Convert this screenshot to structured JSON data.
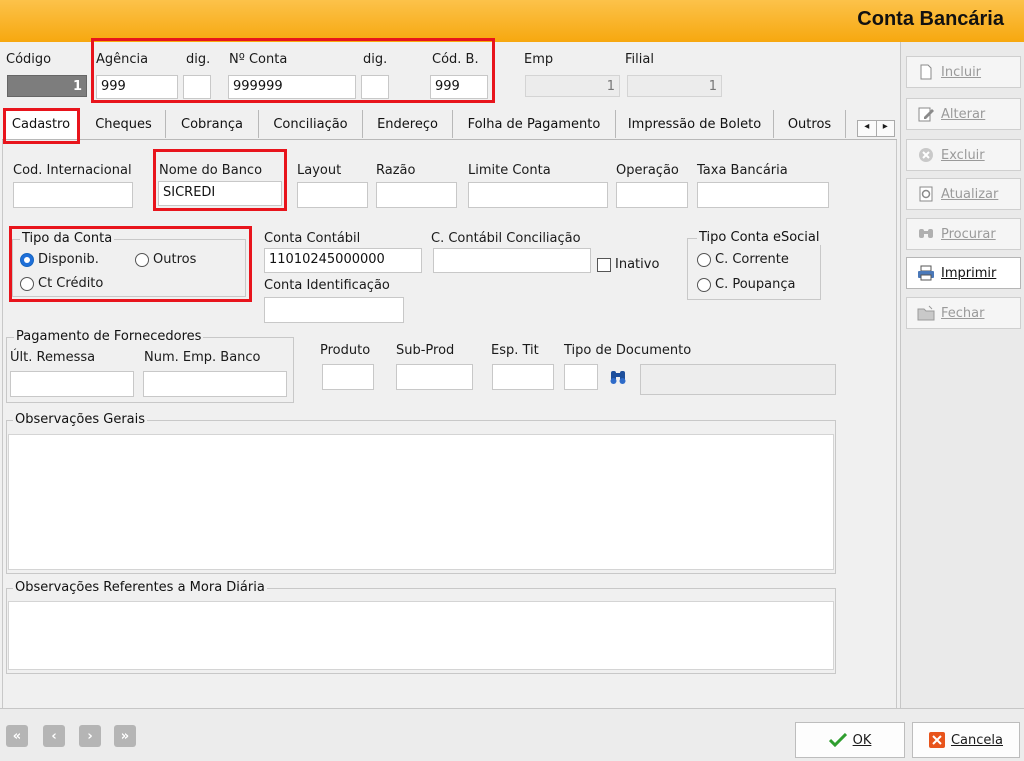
{
  "window": {
    "title": "Conta Bancária"
  },
  "header": {
    "codigo_label": "Código",
    "codigo_value": "1",
    "agencia_label": "Agência",
    "agencia_value": "999",
    "dig1_label": "dig.",
    "dig1_value": "",
    "conta_label": "Nº Conta",
    "conta_value": "999999",
    "dig2_label": "dig.",
    "dig2_value": "",
    "codb_label": "Cód. B.",
    "codb_value": "999",
    "emp_label": "Emp",
    "emp_value": "1",
    "filial_label": "Filial",
    "filial_value": "1"
  },
  "tabs": [
    {
      "label": "Cadastro"
    },
    {
      "label": "Cheques"
    },
    {
      "label": "Cobrança"
    },
    {
      "label": "Conciliação"
    },
    {
      "label": "Endereço"
    },
    {
      "label": "Folha de Pagamento"
    },
    {
      "label": "Impressão de Boleto"
    },
    {
      "label": "Outros"
    }
  ],
  "tab_scroll": {
    "left": "◂",
    "right": "▸"
  },
  "cadastro": {
    "cod_internacional_label": "Cod. Internacional",
    "cod_internacional_value": "",
    "nome_banco_label": "Nome do Banco",
    "nome_banco_value": "SICREDI",
    "layout_label": "Layout",
    "layout_value": "",
    "razao_label": "Razão",
    "razao_value": "",
    "limite_label": "Limite Conta",
    "limite_value": "",
    "operacao_label": "Operação",
    "operacao_value": "",
    "taxa_label": "Taxa Bancária",
    "taxa_value": "",
    "tipo_conta": {
      "title": "Tipo da Conta",
      "options": [
        "Disponib.",
        "Outros",
        "Ct Crédito"
      ],
      "selected": "Disponib."
    },
    "conta_contabil_label": "Conta Contábil",
    "conta_contabil_value": "11010245000000",
    "cc_conciliacao_label": "C. Contábil Conciliação",
    "cc_conciliacao_value": "",
    "inativo_label": "Inativo",
    "conta_ident_label": "Conta Identificação",
    "conta_ident_value": "",
    "tipo_esocial": {
      "title": "Tipo Conta eSocial",
      "options": [
        "C. Corrente",
        "C. Poupança"
      ]
    },
    "pagamento": {
      "title": "Pagamento de Fornecedores",
      "ult_remessa_label": "Últ. Remessa",
      "ult_remessa_value": "",
      "num_emp_label": "Num. Emp. Banco",
      "num_emp_value": ""
    },
    "produto_label": "Produto",
    "produto_value": "",
    "subprod_label": "Sub-Prod",
    "subprod_value": "",
    "esptit_label": "Esp. Tit",
    "esptit_value": "",
    "tipodoc_label": "Tipo de Documento",
    "tipodoc_value": "",
    "tipodoc_desc": "",
    "obs_gerais_title": "Observações Gerais",
    "obs_mora_title": "Observações Referentes a Mora Diária"
  },
  "sidebar": {
    "buttons": [
      {
        "label": "Incluir",
        "icon": "new-document-icon",
        "enabled": false
      },
      {
        "label": "Alterar",
        "icon": "edit-icon",
        "enabled": false
      },
      {
        "label": "Excluir",
        "icon": "delete-icon",
        "enabled": false
      },
      {
        "label": "Atualizar",
        "icon": "refresh-icon",
        "enabled": false
      },
      {
        "label": "Procurar",
        "icon": "binoculars-icon",
        "enabled": false
      },
      {
        "label": "Imprimir",
        "icon": "printer-icon",
        "enabled": true
      },
      {
        "label": "Fechar",
        "icon": "close-folder-icon",
        "enabled": false
      }
    ]
  },
  "footer": {
    "nav": [
      "«",
      "‹",
      "›",
      "»"
    ],
    "ok_label": "OK",
    "cancel_label": "Cancela"
  },
  "colors": {
    "title_bar": "#f7a80f",
    "highlight": "#e8141c",
    "radio_selected": "#1e6fd9"
  }
}
